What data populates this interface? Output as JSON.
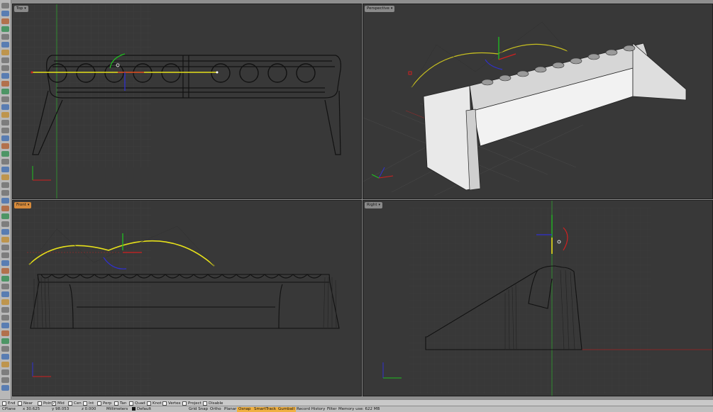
{
  "viewports": {
    "top": {
      "label": "Top"
    },
    "perspective": {
      "label": "Perspective"
    },
    "front": {
      "label": "Front"
    },
    "right": {
      "label": "Right"
    }
  },
  "osnaps": [
    {
      "label": "End",
      "checked": false
    },
    {
      "label": "Near",
      "checked": false
    },
    {
      "label": "Point",
      "checked": false
    },
    {
      "label": "Mid",
      "checked": true
    },
    {
      "label": "Cen",
      "checked": false
    },
    {
      "label": "Int",
      "checked": false
    },
    {
      "label": "Perp",
      "checked": false
    },
    {
      "label": "Tan",
      "checked": false
    },
    {
      "label": "Quad",
      "checked": false
    },
    {
      "label": "Knot",
      "checked": false
    },
    {
      "label": "Vertex",
      "checked": false
    },
    {
      "label": "Project",
      "checked": false
    },
    {
      "label": "Disable",
      "checked": false
    }
  ],
  "status": {
    "cplane": "CPlane",
    "x": "x 30.625",
    "y": "y 98.053",
    "z": "z 0.000",
    "units": "Millimeters",
    "layer": "Default",
    "grid_snap": "Grid Snap",
    "ortho": "Ortho",
    "planar": "Planar",
    "osnap": "Osnap",
    "smarttrack": "SmartTrack",
    "gumball": "Gumball",
    "record_history": "Record History",
    "filter": "Filter",
    "memory": "Memory use: 622 MB"
  },
  "colors": {
    "viewport_bg": "#383838",
    "active_tab": "#d58a3b",
    "curve": "#e6e01a",
    "x_axis": "#d02020",
    "y_axis": "#20c020",
    "z_axis": "#3030d0",
    "status_highlight": "#f0b040"
  }
}
